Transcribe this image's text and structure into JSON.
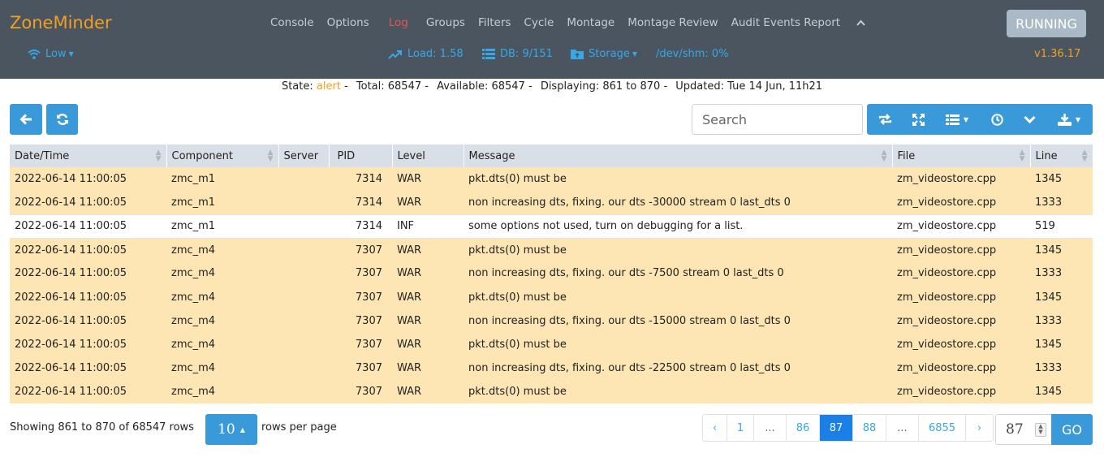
{
  "header": {
    "brand": "ZoneMinder",
    "nav": [
      "Console",
      "Options",
      "Log",
      "Groups",
      "Filters",
      "Cycle",
      "Montage",
      "Montage Review",
      "Audit Events Report"
    ],
    "active_nav": "Log",
    "run_state": "RUNNING",
    "bandwidth": "Low",
    "load": "Load: 1.58",
    "db": "DB: 9/151",
    "storage": "Storage",
    "shm": "/dev/shm: 0%",
    "version": "v1.36.17"
  },
  "state": {
    "label": "State:",
    "value": "alert",
    "total": "Total: 68547",
    "available": "Available: 68547",
    "displaying": "Displaying: 861 to 870",
    "updated": "Updated: Tue 14 Jun, 11h21"
  },
  "search": {
    "placeholder": "Search"
  },
  "table": {
    "columns": [
      "Date/Time",
      "Component",
      "Server",
      "PID",
      "Level",
      "Message",
      "File",
      "Line"
    ],
    "rows": [
      [
        "2022-06-14 11:00:05",
        "zmc_m1",
        "",
        "7314",
        "WAR",
        "pkt.dts(0) must be",
        "zm_videostore.cpp",
        "1345"
      ],
      [
        "2022-06-14 11:00:05",
        "zmc_m1",
        "",
        "7314",
        "WAR",
        "non increasing dts, fixing. our dts -30000 stream 0 last_dts 0",
        "zm_videostore.cpp",
        "1333"
      ],
      [
        "2022-06-14 11:00:05",
        "zmc_m1",
        "",
        "7314",
        "INF",
        "some options not used, turn on debugging for a list.",
        "zm_videostore.cpp",
        "519"
      ],
      [
        "2022-06-14 11:00:05",
        "zmc_m4",
        "",
        "7307",
        "WAR",
        "pkt.dts(0) must be",
        "zm_videostore.cpp",
        "1345"
      ],
      [
        "2022-06-14 11:00:05",
        "zmc_m4",
        "",
        "7307",
        "WAR",
        "non increasing dts, fixing. our dts -7500 stream 0 last_dts 0",
        "zm_videostore.cpp",
        "1333"
      ],
      [
        "2022-06-14 11:00:05",
        "zmc_m4",
        "",
        "7307",
        "WAR",
        "pkt.dts(0) must be",
        "zm_videostore.cpp",
        "1345"
      ],
      [
        "2022-06-14 11:00:05",
        "zmc_m4",
        "",
        "7307",
        "WAR",
        "non increasing dts, fixing. our dts -15000 stream 0 last_dts 0",
        "zm_videostore.cpp",
        "1333"
      ],
      [
        "2022-06-14 11:00:05",
        "zmc_m4",
        "",
        "7307",
        "WAR",
        "pkt.dts(0) must be",
        "zm_videostore.cpp",
        "1345"
      ],
      [
        "2022-06-14 11:00:05",
        "zmc_m4",
        "",
        "7307",
        "WAR",
        "non increasing dts, fixing. our dts -22500 stream 0 last_dts 0",
        "zm_videostore.cpp",
        "1333"
      ],
      [
        "2022-06-14 11:00:05",
        "zmc_m4",
        "",
        "7307",
        "WAR",
        "pkt.dts(0) must be",
        "zm_videostore.cpp",
        "1345"
      ]
    ]
  },
  "pagination": {
    "showing": "Showing 861 to 870 of 68547 rows",
    "per_page": "10",
    "rows_per_page": "rows per page",
    "pages": [
      "‹",
      "1",
      "...",
      "86",
      "87",
      "88",
      "...",
      "6855",
      "›"
    ],
    "active_page": "87",
    "goto_value": "87",
    "go_label": "GO"
  },
  "colors": {
    "header_bg": "#4b5560",
    "brand": "#f0a020",
    "accent": "#3a9ad9",
    "warning_row": "#fde5b4",
    "active_page": "#1b7fe8"
  }
}
